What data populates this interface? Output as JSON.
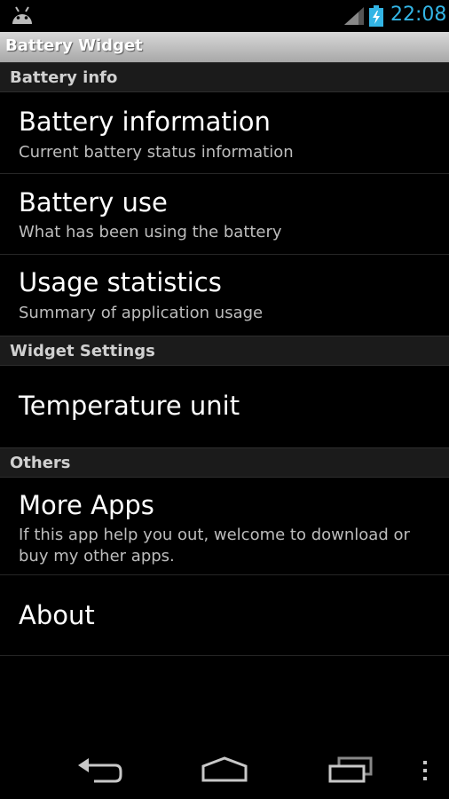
{
  "status_bar": {
    "time": "22:08",
    "icons": [
      "android-icon",
      "signal-icon",
      "battery-charging-icon"
    ],
    "accent_color": "#33b5e5"
  },
  "app_bar": {
    "title": "Battery Widget"
  },
  "sections": [
    {
      "header": "Battery info",
      "items": [
        {
          "title": "Battery information",
          "summary": "Current battery status information"
        },
        {
          "title": "Battery use",
          "summary": "What has been using the battery"
        },
        {
          "title": "Usage statistics",
          "summary": "Summary of application usage"
        }
      ]
    },
    {
      "header": "Widget Settings",
      "items": [
        {
          "title": "Temperature unit"
        }
      ]
    },
    {
      "header": "Others",
      "items": [
        {
          "title": "More Apps",
          "summary": "If this app help you out, welcome to download or buy my other apps."
        },
        {
          "title": "About"
        }
      ]
    }
  ],
  "nav_bar": {
    "icons": [
      "back-icon",
      "home-icon",
      "recent-apps-icon",
      "overflow-menu-icon"
    ]
  }
}
